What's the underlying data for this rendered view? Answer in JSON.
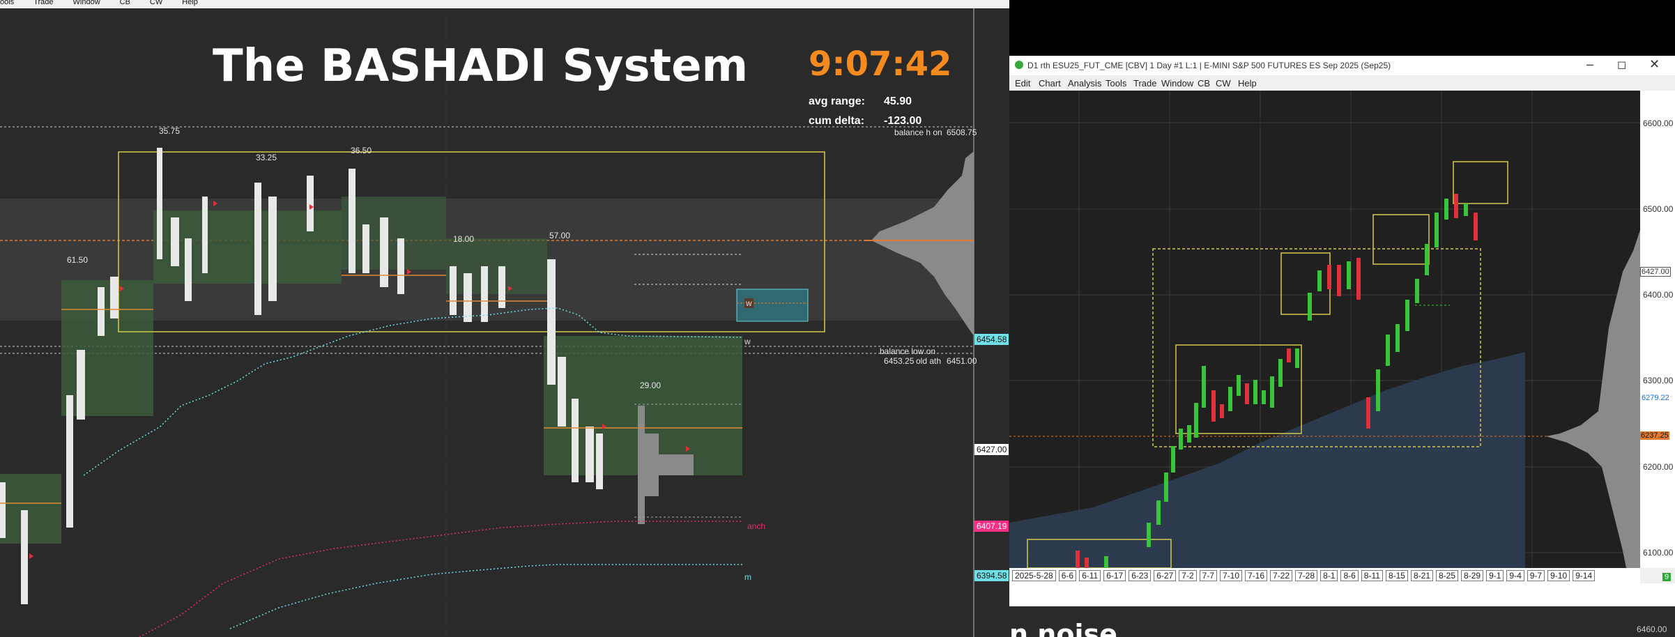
{
  "left_window": {
    "menu": [
      "ools",
      "Trade",
      "Window",
      "CB",
      "CW",
      "Help"
    ],
    "title": "The BASHADI System",
    "clock": "9:07:42",
    "stats": [
      {
        "label": "avg range:",
        "value": "45.90"
      },
      {
        "label": "cum delta:",
        "value": "-123.00"
      }
    ],
    "annotations": {
      "balance_high": "balance h on",
      "balance_high_value": "6508.75",
      "balance_low": "balance low on",
      "balance_low_value": "6453.25",
      "old_ath": "old ath",
      "old_ath_value": "6451.00",
      "anch": "anch",
      "m": "m",
      "w_marker": "w",
      "w_box": "w"
    },
    "range_labels": [
      "35.75",
      "33.25",
      "36.50",
      "61.50",
      "18.00",
      "57.00",
      "29.00"
    ],
    "price_tags": [
      {
        "value": "6454.58",
        "color": "#6fe0e8"
      },
      {
        "value": "6427.00",
        "color": "#ffffff"
      },
      {
        "value": "6407.19",
        "color": "#ff2f86"
      },
      {
        "value": "6394.58",
        "color": "#6fe0e8"
      }
    ],
    "colors": {
      "clock": "#f58a1f",
      "background": "#2a2a2a",
      "profile_box": "#3a5a3a",
      "balance_box": "#d6c94a"
    }
  },
  "right_window": {
    "title": "D1 rth ESU25_FUT_CME [CBV]  1 Day  #1 L:1 | E-MINI S&P 500 FUTURES ES Sep 2025 (Sep25)",
    "menu": [
      "Edit",
      "Chart",
      "Analysis",
      "Tools",
      "Trade",
      "Window",
      "CB",
      "CW",
      "Help"
    ],
    "price_axis": [
      "6600.00",
      "6500.00",
      "6400.00",
      "6300.00",
      "6200.00",
      "6100.00"
    ],
    "price_tags": [
      {
        "value": "6427.00",
        "color": "#ffffff"
      },
      {
        "value": "6279.22",
        "color": "#1a6fd6"
      },
      {
        "value": "6237.25",
        "color": "#e07a2f"
      }
    ],
    "badge": "9",
    "dates": [
      "2025-5-28",
      "6-6",
      "6-11",
      "6-17",
      "6-23",
      "6-27",
      "7-2",
      "7-7",
      "7-10",
      "7-16",
      "7-22",
      "7-28",
      "8-1",
      "8-6",
      "8-11",
      "8-15",
      "8-21",
      "8-25",
      "8-29",
      "9-1",
      "9-4",
      "9-7",
      "9-10",
      "9-14"
    ],
    "below_axis_value": "6460.00",
    "bottom_text": "n noise",
    "window_controls": [
      "minimize-icon",
      "maximize-icon",
      "close-icon"
    ]
  }
}
